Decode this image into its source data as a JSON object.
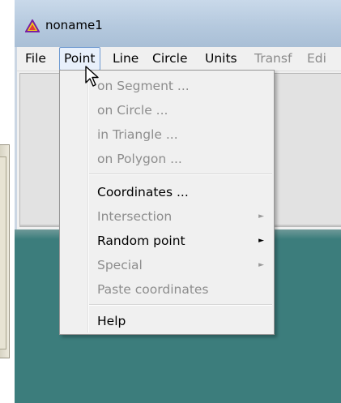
{
  "window": {
    "title": "noname1"
  },
  "menubar": {
    "items": [
      {
        "label": "File",
        "disabled": false
      },
      {
        "label": "Point",
        "disabled": false,
        "open": true
      },
      {
        "label": "Line",
        "disabled": false
      },
      {
        "label": "Circle",
        "disabled": false
      },
      {
        "label": "Units",
        "disabled": false
      },
      {
        "label": "Transf",
        "disabled": true
      },
      {
        "label": "Edi",
        "disabled": true
      }
    ]
  },
  "point_menu": {
    "items": [
      {
        "label": "on Segment ...",
        "disabled": true
      },
      {
        "label": "on Circle ...",
        "disabled": true
      },
      {
        "label": "in Triangle ...",
        "disabled": true
      },
      {
        "label": "on Polygon ...",
        "disabled": true
      },
      {
        "label": "Coordinates ...",
        "disabled": false
      },
      {
        "label": "Intersection",
        "disabled": true,
        "submenu": true
      },
      {
        "label": "Random point",
        "disabled": false,
        "submenu": true
      },
      {
        "label": "Special",
        "disabled": true,
        "submenu": true
      },
      {
        "label": "Paste coordinates",
        "disabled": true
      },
      {
        "label": "Help",
        "disabled": false
      }
    ],
    "submenu_glyph": "►"
  },
  "colors": {
    "canvas": "#3c7d7c",
    "menu_bg": "#f0f0f0",
    "disabled_text": "#8d8d8d",
    "titlebar": "#b5c9de"
  },
  "icons": {
    "app": "triangle-app-icon",
    "cursor": "mouse-pointer-icon"
  }
}
